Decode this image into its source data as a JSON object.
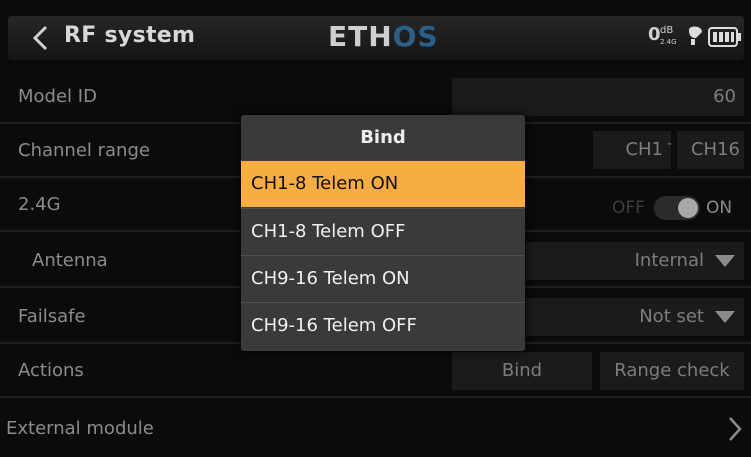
{
  "header": {
    "title": "RF system",
    "logo_part1": "ETH",
    "logo_part2": "OS",
    "rssi_value": "0",
    "rssi_unit": "dB",
    "rssi_band": "2.4G",
    "icons": [
      "chevron-left-icon",
      "satellite-icon",
      "battery-icon"
    ]
  },
  "rows": {
    "model_id": {
      "label": "Model ID",
      "value": "60"
    },
    "channel_range": {
      "label": "Channel range",
      "from": "CH1",
      "sep": "-",
      "to": "CH16"
    },
    "band": {
      "label": "2.4G",
      "off": "OFF",
      "on": "ON"
    },
    "antenna": {
      "label": "Antenna",
      "value": "Internal"
    },
    "failsafe": {
      "label": "Failsafe",
      "value": "Not set"
    },
    "actions": {
      "label": "Actions",
      "bind": "Bind",
      "range": "Range check"
    },
    "external": {
      "label": "External module"
    }
  },
  "modal": {
    "title": "Bind",
    "options": [
      "CH1-8 Telem ON",
      "CH1-8 Telem OFF",
      "CH9-16 Telem ON",
      "CH9-16 Telem OFF"
    ],
    "selected_index": 0
  },
  "colors": {
    "accent": "#f8ad43",
    "logo_accent": "#2b5f88"
  }
}
